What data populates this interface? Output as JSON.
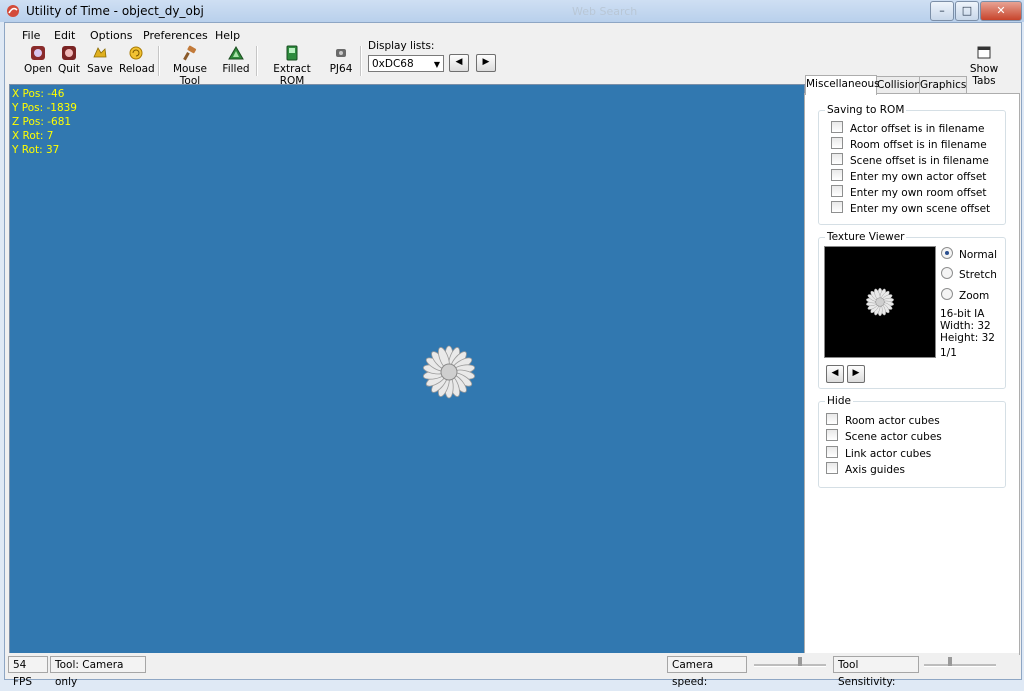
{
  "window": {
    "title": "Utility of Time - object_dy_obj",
    "faint_text": "Web Search"
  },
  "menu": [
    "File",
    "Edit",
    "Options",
    "Preferences",
    "Help"
  ],
  "toolbar": {
    "open": "Open",
    "quit": "Quit",
    "save": "Save",
    "reload": "Reload",
    "mouse_tool": "Mouse Tool",
    "filled": "Filled",
    "extract_rom": "Extract ROM",
    "pj64": "PJ64",
    "display_lists_label": "Display lists:",
    "display_list_value": "0xDC68",
    "show_tabs": "Show Tabs"
  },
  "viewport": {
    "background": "#3178b0",
    "hud": [
      "X Pos: -46",
      "Y Pos: -1839",
      "Z Pos: -681",
      "X Rot: 7",
      "Y Rot: 37"
    ],
    "hud_color": "#ffff00"
  },
  "tabs": [
    "Miscellaneous",
    "Collision",
    "Graphics"
  ],
  "saving_to_rom": {
    "title": "Saving to ROM",
    "options": [
      "Actor offset is in filename",
      "Room offset is in filename",
      "Scene offset is in filename",
      "Enter my own actor offset",
      "Enter my own room offset",
      "Enter my own scene offset"
    ]
  },
  "texture_viewer": {
    "title": "Texture Viewer",
    "modes": [
      "Normal",
      "Stretch",
      "Zoom"
    ],
    "selected_mode": "Normal",
    "format": "16-bit IA",
    "width": "Width: 32",
    "height": "Height: 32",
    "page": "1/1"
  },
  "hide": {
    "title": "Hide",
    "options": [
      "Room actor cubes",
      "Scene actor cubes",
      "Link actor cubes",
      "Axis guides"
    ]
  },
  "status": {
    "fps": "54 FPS",
    "tool": "Tool: Camera only",
    "camera_speed": "Camera speed:",
    "tool_sensitivity": "Tool Sensitivity:"
  }
}
